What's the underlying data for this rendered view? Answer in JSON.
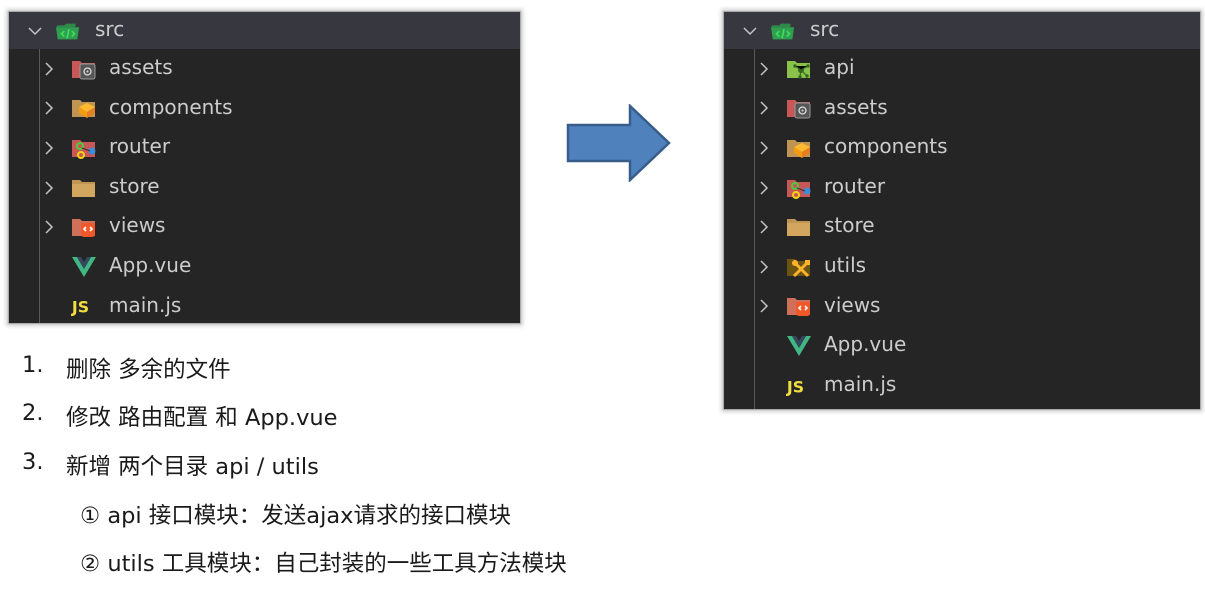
{
  "before_tree": {
    "root": {
      "label": "src",
      "icon": "folder-src-open-icon",
      "expanded": true
    },
    "items": [
      {
        "label": "assets",
        "type": "folder",
        "icon": "folder-assets-icon"
      },
      {
        "label": "components",
        "type": "folder",
        "icon": "folder-components-icon"
      },
      {
        "label": "router",
        "type": "folder",
        "icon": "folder-router-icon"
      },
      {
        "label": "store",
        "type": "folder",
        "icon": "folder-icon"
      },
      {
        "label": "views",
        "type": "folder",
        "icon": "folder-views-icon"
      },
      {
        "label": "App.vue",
        "type": "file",
        "icon": "vue-icon"
      },
      {
        "label": "main.js",
        "type": "file",
        "icon": "js-icon"
      }
    ]
  },
  "after_tree": {
    "root": {
      "label": "src",
      "icon": "folder-src-open-icon",
      "expanded": true
    },
    "items": [
      {
        "label": "api",
        "type": "folder",
        "icon": "folder-api-icon"
      },
      {
        "label": "assets",
        "type": "folder",
        "icon": "folder-assets-icon"
      },
      {
        "label": "components",
        "type": "folder",
        "icon": "folder-components-icon"
      },
      {
        "label": "router",
        "type": "folder",
        "icon": "folder-router-icon"
      },
      {
        "label": "store",
        "type": "folder",
        "icon": "folder-icon"
      },
      {
        "label": "utils",
        "type": "folder",
        "icon": "folder-utils-icon"
      },
      {
        "label": "views",
        "type": "folder",
        "icon": "folder-views-icon"
      },
      {
        "label": "App.vue",
        "type": "file",
        "icon": "vue-icon"
      },
      {
        "label": "main.js",
        "type": "file",
        "icon": "js-icon"
      }
    ]
  },
  "arrow": {
    "icon": "right-arrow-icon",
    "color": "#4f81bd",
    "border": "#385d8a"
  },
  "notes": {
    "items": [
      {
        "num": "1.",
        "text": "删除 多余的文件"
      },
      {
        "num": "2.",
        "text": "修改 路由配置 和 App.vue"
      },
      {
        "num": "3.",
        "text": "新增 两个目录 api / utils"
      }
    ],
    "subitems": [
      {
        "text": "① api 接口模块：发送ajax请求的接口模块"
      },
      {
        "text": "② utils 工具模块：自己封装的一些工具方法模块"
      }
    ]
  },
  "colors": {
    "panel_bg": "#252526",
    "root_row_bg": "#37373f",
    "tree_text": "#cccccc",
    "js_yellow": "#f1dd3f",
    "vue_green": "#41b883",
    "vue_dark": "#35495e"
  }
}
